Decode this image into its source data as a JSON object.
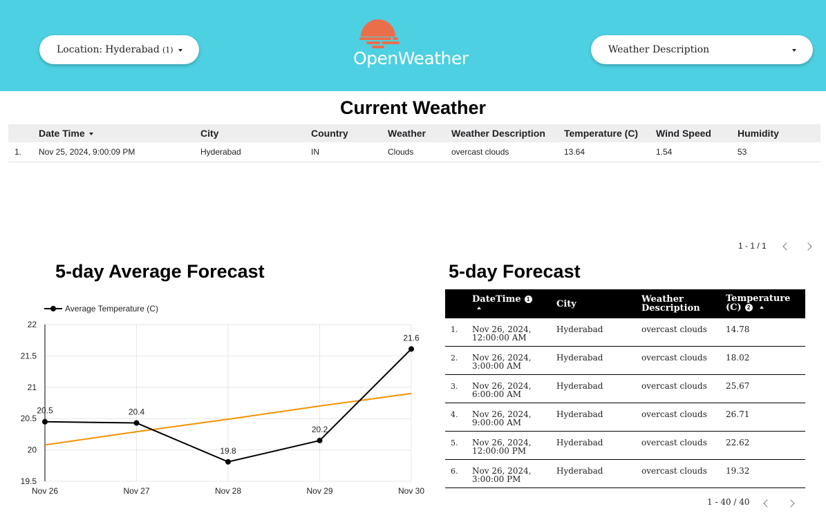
{
  "header": {
    "location_key": "Location:",
    "location_value": "Hyderabad",
    "location_count": "(1)",
    "weather_desc_label": "Weather Description",
    "logo_text": "OpenWeather",
    "colors": {
      "header_bg": "#4dd0e1",
      "logo_sun": "#eb6e4b"
    }
  },
  "current": {
    "title": "Current Weather",
    "columns": [
      "Date Time",
      "City",
      "Country",
      "Weather",
      "Weather Description",
      "Temperature (C)",
      "Wind Speed",
      "Humidity"
    ],
    "rows": [
      {
        "index": "1.",
        "cells": [
          "Nov 25, 2024, 9:00:09 PM",
          "Hyderabad",
          "IN",
          "Clouds",
          "overcast clouds",
          "13.64",
          "1.54",
          "53"
        ]
      }
    ],
    "pager": "1 - 1 / 1"
  },
  "chart_title": "5-day Average Forecast",
  "chart_data": {
    "type": "line",
    "x": [
      "Nov 26",
      "Nov 27",
      "Nov 28",
      "Nov 29",
      "Nov 30"
    ],
    "series": [
      {
        "name": "Average Temperature (C)",
        "values": [
          20.45,
          20.43,
          19.81,
          20.15,
          21.61
        ],
        "labels": [
          "20.5",
          "20.4",
          "19.8",
          "20.2",
          "21.6"
        ],
        "color": "#000000"
      },
      {
        "trendline": true,
        "values": [
          20.08,
          20.29,
          20.49,
          20.7,
          20.9
        ],
        "color": "#f29100"
      }
    ],
    "yticks": [
      "22",
      "21.5",
      "21",
      "20.5",
      "20",
      "19.5"
    ],
    "ylim": [
      19.5,
      22
    ],
    "legend": "top-left",
    "grid": true
  },
  "forecast": {
    "title": "5-day Forecast",
    "columns": {
      "datetime": "DateTime",
      "datetime_info": "1",
      "city": "City",
      "desc_line1": "Weather",
      "desc_line2": "Description",
      "temp_line1": "Temperature",
      "temp_line2": "(C)",
      "temp_info": "2"
    },
    "rows": [
      {
        "index": "1.",
        "date": "Nov 26, 2024,",
        "time": "12:00:00 AM",
        "city": "Hyderabad",
        "desc": "overcast clouds",
        "temp": "14.78"
      },
      {
        "index": "2.",
        "date": "Nov 26, 2024,",
        "time": "3:00:00 AM",
        "city": "Hyderabad",
        "desc": "overcast clouds",
        "temp": "18.02"
      },
      {
        "index": "3.",
        "date": "Nov 26, 2024,",
        "time": "6:00:00 AM",
        "city": "Hyderabad",
        "desc": "overcast clouds",
        "temp": "25.67"
      },
      {
        "index": "4.",
        "date": "Nov 26, 2024,",
        "time": "9:00:00 AM",
        "city": "Hyderabad",
        "desc": "overcast clouds",
        "temp": "26.71"
      },
      {
        "index": "5.",
        "date": "Nov 26, 2024,",
        "time": "12:00:00 PM",
        "city": "Hyderabad",
        "desc": "overcast clouds",
        "temp": "22.62"
      },
      {
        "index": "6.",
        "date": "Nov 26, 2024,",
        "time": "3:00:00 PM",
        "city": "Hyderabad",
        "desc": "overcast clouds",
        "temp": "19.32"
      }
    ],
    "pager": "1 - 40 / 40"
  }
}
